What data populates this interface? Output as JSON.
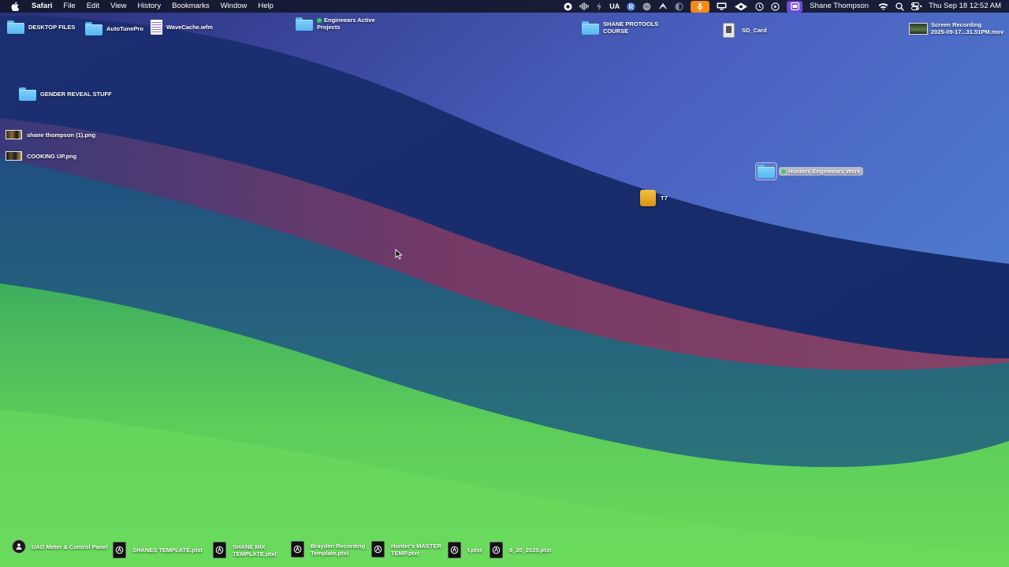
{
  "menubar": {
    "app_name": "Safari",
    "menus": [
      "File",
      "Edit",
      "View",
      "History",
      "Bookmarks",
      "Window",
      "Help"
    ],
    "status_items": {
      "ua_label": "UA",
      "user_name": "Shane Thompson",
      "datetime": "Thu Sep 18  12:52 AM"
    },
    "icons": [
      "apple-icon",
      "camera-control-icon",
      "audio-waveform-icon",
      "bolt-icon",
      "ua-icon",
      "r-app-icon",
      "record-dot-icon",
      "sync-icon",
      "half-circle-icon",
      "microphone-icon",
      "display-icon",
      "ear-icon",
      "clock-icon",
      "play-circle-icon",
      "window-icon",
      "wifi-icon",
      "search-icon",
      "control-center-icon"
    ],
    "accent_colors": {
      "mic": "#f28b18",
      "window": "#6e4ad8"
    }
  },
  "desktop": {
    "items": [
      {
        "label": "DESKTOP FILES",
        "kind": "folder"
      },
      {
        "label": "AutoTunePro",
        "kind": "folder"
      },
      {
        "label": "WaveCache.wfm",
        "kind": "file"
      },
      {
        "label": "Engineears Active Projects",
        "kind": "folder",
        "tag": "green"
      },
      {
        "label": "SHANE PROTOOLS COURSE",
        "kind": "folder"
      },
      {
        "label": "SD_Card",
        "kind": "volume"
      },
      {
        "label": "Screen Recording 2025-09-17...31.51PM.mov",
        "kind": "video"
      },
      {
        "label": "GENDER REVEAL STUFF",
        "kind": "folder"
      },
      {
        "label": "shane thompson (1).png",
        "kind": "image"
      },
      {
        "label": "COOKING UP.png",
        "kind": "image"
      },
      {
        "label": "Hunters Engineears Work",
        "kind": "folder",
        "tag": "green",
        "selected": true
      },
      {
        "label": "T7",
        "kind": "drive"
      },
      {
        "label": "UAD Meter & Control Panel",
        "kind": "app"
      },
      {
        "label": "SHANES TEMPLATE.ptxt",
        "kind": "template"
      },
      {
        "label": "SHANE MIX TEMPLATE.ptxt",
        "kind": "template"
      },
      {
        "label": "Brayden Recording Template.ptxt",
        "kind": "template"
      },
      {
        "label": "Hunter's MASTER TEMP.ptxt",
        "kind": "template"
      },
      {
        "label": "t.ptxt",
        "kind": "template"
      },
      {
        "label": "8_20_2025.ptxt",
        "kind": "template"
      }
    ],
    "label_lines": {
      "engineears_1": "Engineears Active",
      "engineears_2": "Projects",
      "shane_course_1": "SHANE PROTOOLS",
      "shane_course_2": "COURSE",
      "recording_1": "Screen Recording",
      "recording_2": "2025-09-17...31.51PM.mov",
      "shane_mix_1": "SHANE MIX",
      "shane_mix_2": "TEMPLATE.ptxt",
      "brayden_1": "Brayden Recording",
      "brayden_2": "Template.ptxt",
      "hunters_master_1": "Hunter's MASTER",
      "hunters_master_2": "TEMP.ptxt"
    }
  }
}
